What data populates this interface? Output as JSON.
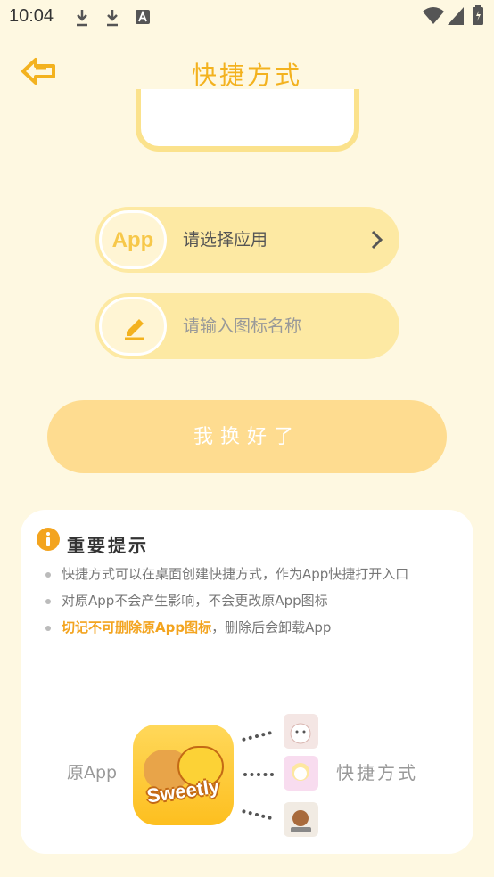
{
  "status_bar": {
    "time": "10:04"
  },
  "header": {
    "title": "快捷方式"
  },
  "select_app": {
    "badge": "App",
    "label": "请选择应用"
  },
  "icon_name": {
    "placeholder": "请输入图标名称"
  },
  "confirm_button": {
    "label": "我换好了"
  },
  "tips_card": {
    "title": "重要提示",
    "items": [
      "快捷方式可以在桌面创建快捷方式，作为App快捷打开入口",
      "对原App不会产生影响，不会更改原App图标"
    ],
    "warning_strong": "切记不可删除原App图标",
    "warning_rest": "，删除后会卸载App",
    "original_label": "原App",
    "app_icon_word": "Sweetly",
    "shortcut_label": "快捷方式"
  },
  "colors": {
    "accent": "#f3b21f",
    "pill_bg": "#fde9a3",
    "page_bg": "#fef8e1",
    "button_bg": "#fedc90"
  }
}
